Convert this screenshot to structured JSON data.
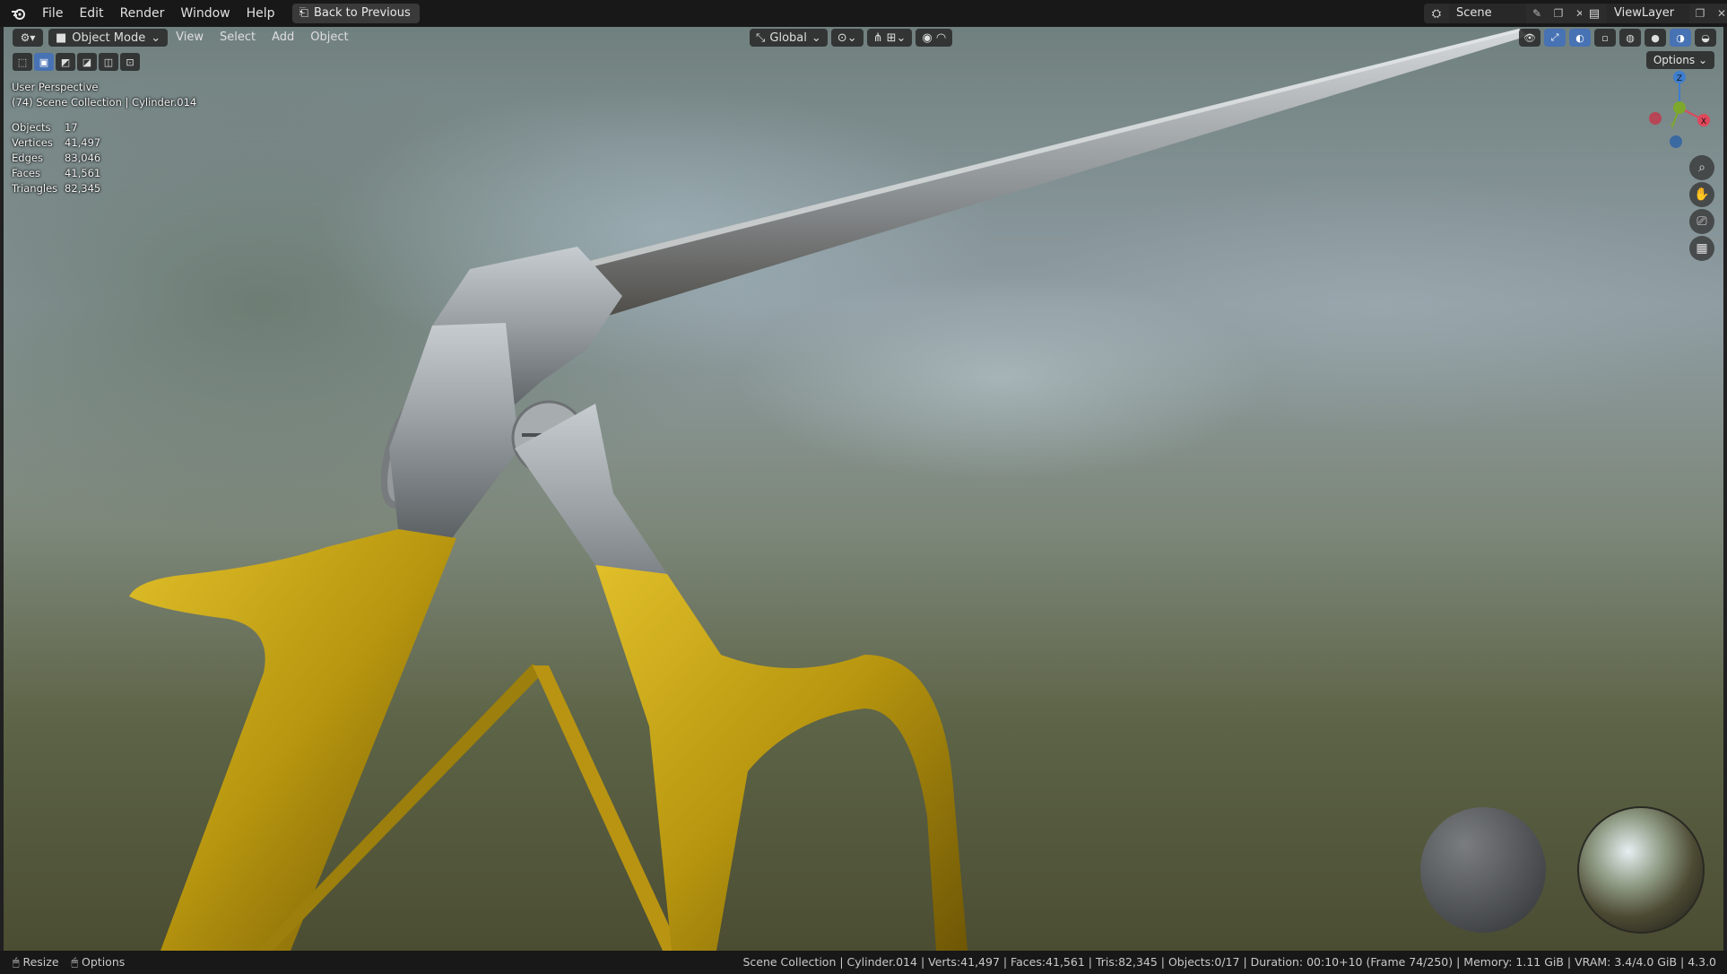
{
  "topbar": {
    "menus": [
      "File",
      "Edit",
      "Render",
      "Window",
      "Help"
    ],
    "back_button": "Back to Previous",
    "scene_name": "Scene",
    "view_layer": "ViewLayer"
  },
  "viewport_header": {
    "mode": "Object Mode",
    "menus": [
      "View",
      "Select",
      "Add",
      "Object"
    ],
    "transform_orientation": "Global",
    "options_label": "Options"
  },
  "overlay": {
    "view_name": "User Perspective",
    "collection_line": "(74) Scene Collection | Cylinder.014",
    "stats": [
      {
        "key": "Objects",
        "value": "17"
      },
      {
        "key": "Vertices",
        "value": "41,497"
      },
      {
        "key": "Edges",
        "value": "83,046"
      },
      {
        "key": "Faces",
        "value": "41,561"
      },
      {
        "key": "Triangles",
        "value": "82,345"
      }
    ]
  },
  "gizmo_axes": [
    "Z",
    "Y",
    "X"
  ],
  "statusbar": {
    "left_items": [
      "Resize",
      "Options"
    ],
    "right_text": "Scene Collection | Cylinder.014 | Verts:41,497 | Faces:41,561 | Tris:82,345 | Objects:0/17 | Duration: 00:10+10 (Frame 74/250) | Memory: 1.11 GiB | VRAM: 3.4/4.0 GiB | 4.3.0"
  },
  "colors": {
    "accent": "#4772b3",
    "gold": "#b8960f",
    "steel": "#9aa0a4",
    "axis_x": "#e0475a",
    "axis_y": "#7ea82c",
    "axis_z": "#3d7ed0"
  },
  "icons": [
    "blender-logo-icon",
    "back-icon",
    "scene-icon",
    "pin-icon",
    "view-layer-icon",
    "editor-type-icon",
    "object-mode-icon",
    "transform-icon",
    "snap-icon",
    "proportional-icon",
    "visibility-icon",
    "gizmo-icon",
    "overlay-icon",
    "xray-icon",
    "wireframe-icon",
    "solid-icon",
    "material-icon",
    "rendered-icon",
    "zoom-icon",
    "pan-icon",
    "camera-icon",
    "grid-icon"
  ]
}
